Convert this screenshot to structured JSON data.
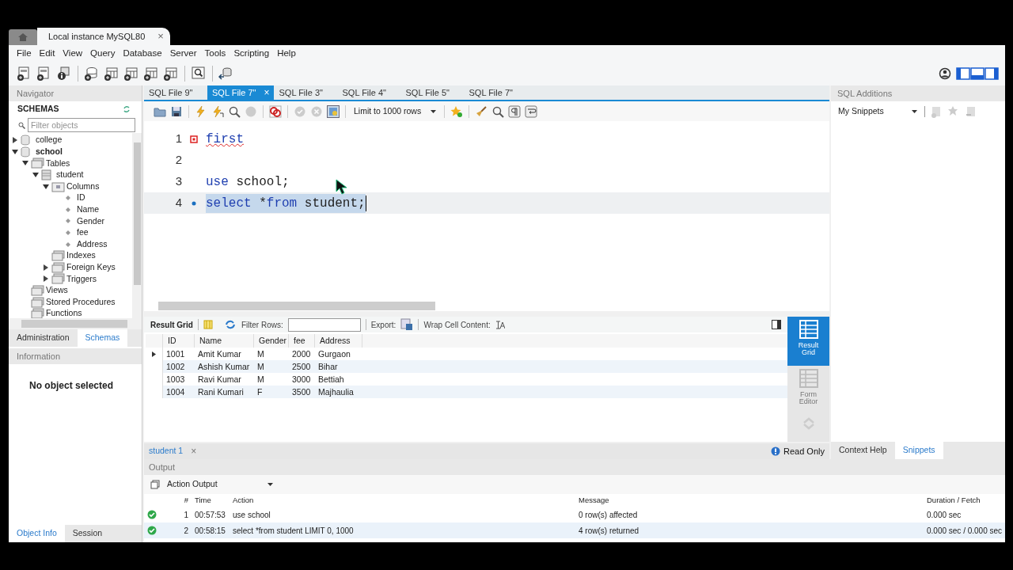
{
  "window": {
    "tabs": [
      {
        "kind": "home",
        "selected": false
      },
      {
        "kind": "connection",
        "label": "Local instance MySQL80",
        "close": "×",
        "selected": true
      }
    ]
  },
  "menu": [
    "File",
    "Edit",
    "View",
    "Query",
    "Database",
    "Server",
    "Tools",
    "Scripting",
    "Help"
  ],
  "navigator": {
    "title": "Navigator",
    "section": "SCHEMAS",
    "filter": {
      "placeholder": "Filter objects"
    },
    "tree": [
      {
        "label": "college",
        "kind": "schema",
        "expanded": false,
        "default": false
      },
      {
        "label": "school",
        "kind": "schema",
        "expanded": true,
        "default": true,
        "children": [
          {
            "label": "Tables",
            "kind": "folder",
            "expanded": true,
            "children": [
              {
                "label": "student",
                "kind": "table",
                "expanded": true,
                "children": [
                  {
                    "label": "Columns",
                    "kind": "columns",
                    "expanded": true,
                    "children": [
                      {
                        "label": "ID",
                        "kind": "column"
                      },
                      {
                        "label": "Name",
                        "kind": "column"
                      },
                      {
                        "label": "Gender",
                        "kind": "column"
                      },
                      {
                        "label": "fee",
                        "kind": "column"
                      },
                      {
                        "label": "Address",
                        "kind": "column"
                      }
                    ]
                  },
                  {
                    "label": "Indexes",
                    "kind": "folder"
                  },
                  {
                    "label": "Foreign Keys",
                    "kind": "folder",
                    "expanded": false
                  },
                  {
                    "label": "Triggers",
                    "kind": "folder",
                    "expanded": false
                  }
                ]
              }
            ]
          },
          {
            "label": "Views",
            "kind": "folder"
          },
          {
            "label": "Stored Procedures",
            "kind": "folder"
          },
          {
            "label": "Functions",
            "kind": "folder"
          }
        ]
      }
    ],
    "tabs": [
      {
        "label": "Administration",
        "selected": false
      },
      {
        "label": "Schemas",
        "selected": true
      }
    ],
    "information": {
      "title": "Information",
      "message": "No object selected"
    },
    "bottom_tabs": [
      {
        "label": "Object Info",
        "selected": true
      },
      {
        "label": "Session",
        "selected": false
      }
    ]
  },
  "editor": {
    "tabs": [
      {
        "label": "SQL File 9\"",
        "selected": false
      },
      {
        "label": "SQL File 7\"",
        "selected": true,
        "close": "×"
      },
      {
        "label": "SQL File 3\"",
        "selected": false
      },
      {
        "label": "SQL File 4\"",
        "selected": false
      },
      {
        "label": "SQL File 5\"",
        "selected": false
      },
      {
        "label": "SQL File 7\"",
        "selected": false
      }
    ],
    "limit": "Limit to 1000 rows",
    "lines": [
      {
        "number": "1",
        "error": true,
        "executable": false,
        "selected": false,
        "tokens": [
          {
            "text": "first",
            "kind": "error"
          }
        ]
      },
      {
        "number": "2",
        "error": false,
        "executable": false,
        "selected": false
      },
      {
        "number": "3",
        "error": false,
        "executable": false,
        "selected": false,
        "tokens": [
          {
            "text": "use",
            "kind": "keyword"
          },
          {
            "text": " school;",
            "kind": "plain"
          }
        ]
      },
      {
        "number": "4",
        "error": false,
        "executable": true,
        "selected": true,
        "tokens": [
          {
            "text": "select",
            "kind": "keyword"
          },
          {
            "text": " *",
            "kind": "plain"
          },
          {
            "text": "from",
            "kind": "keyword"
          },
          {
            "text": " student;",
            "kind": "plain"
          }
        ]
      }
    ]
  },
  "result": {
    "toolbar": {
      "title": "Result Grid",
      "filter_label": "Filter Rows:",
      "export_label": "Export:",
      "wrap_label": "Wrap Cell Content:"
    },
    "columns": [
      "ID",
      "Name",
      "Gender",
      "fee",
      "Address"
    ],
    "rows": [
      {
        "current": true,
        "cells": [
          "1001",
          "Amit Kumar",
          "M",
          "2000",
          "Gurgaon"
        ]
      },
      {
        "current": false,
        "cells": [
          "1002",
          "Ashish Kumar",
          "M",
          "2500",
          "Bihar"
        ]
      },
      {
        "current": false,
        "cells": [
          "1003",
          "Ravi Kumar",
          "M",
          "3000",
          "Bettiah"
        ]
      },
      {
        "current": false,
        "cells": [
          "1004",
          "Rani Kumari",
          "F",
          "3500",
          "Majhaulia"
        ]
      }
    ],
    "views": [
      {
        "label": "Result Grid",
        "selected": true
      },
      {
        "label": "Form Editor",
        "selected": false
      }
    ],
    "tabs": [
      {
        "label": "student 1",
        "close": "×"
      }
    ],
    "status": "Read Only"
  },
  "sql_additions": {
    "title": "SQL Additions",
    "snippets": "My Snippets",
    "tabs": [
      {
        "label": "Context Help",
        "selected": false
      },
      {
        "label": "Snippets",
        "selected": true
      }
    ]
  },
  "output": {
    "title": "Output",
    "mode": "Action Output",
    "columns": [
      "#",
      "Time",
      "Action",
      "Message",
      "Duration / Fetch"
    ],
    "rows": [
      {
        "success": true,
        "cells": [
          "1",
          "00:57:53",
          "use school",
          "0 row(s) affected",
          "0.000 sec"
        ]
      },
      {
        "success": true,
        "cells": [
          "2",
          "00:58:15",
          "select *from student LIMIT 0, 1000",
          "4 row(s) returned",
          "0.000 sec / 0.000 sec"
        ]
      }
    ]
  }
}
